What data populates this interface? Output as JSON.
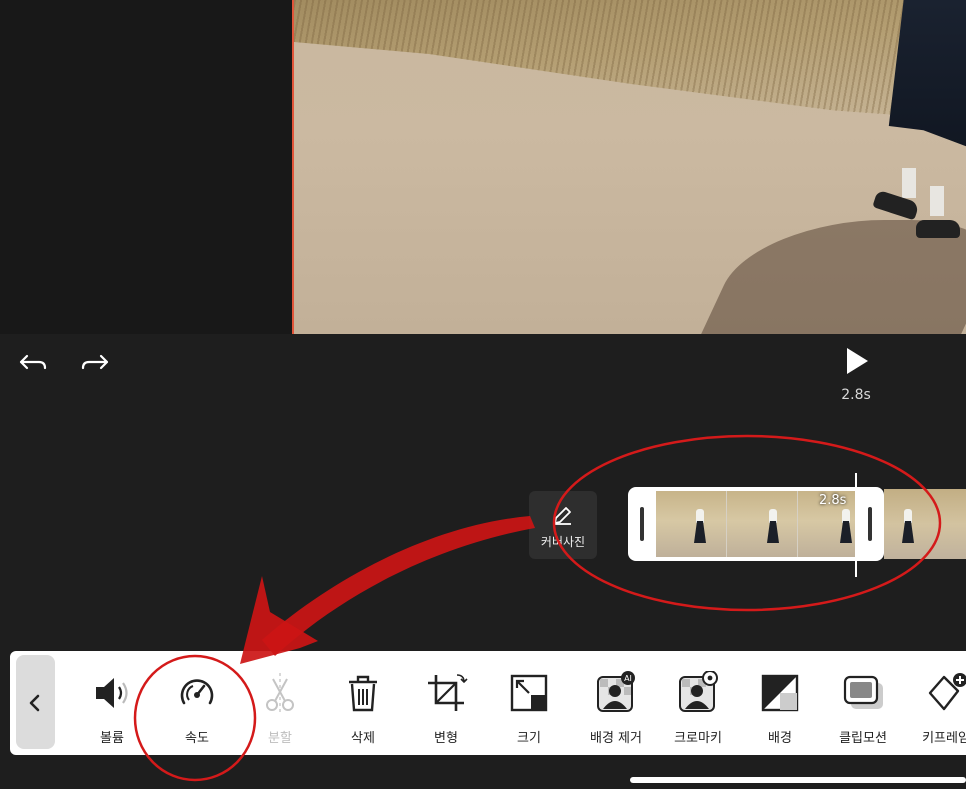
{
  "player": {
    "duration_label": "2.8s"
  },
  "timeline": {
    "cover_photo_label": "커버사진",
    "clip_duration_label": "2.8s"
  },
  "toolbar": {
    "tools": [
      {
        "label": "볼륨",
        "icon": "volume-icon",
        "enabled": true
      },
      {
        "label": "속도",
        "icon": "speedometer-icon",
        "enabled": true
      },
      {
        "label": "분할",
        "icon": "scissors-icon",
        "enabled": false
      },
      {
        "label": "삭제",
        "icon": "trash-icon",
        "enabled": true
      },
      {
        "label": "변형",
        "icon": "crop-rotate-icon",
        "enabled": true
      },
      {
        "label": "크기",
        "icon": "resize-icon",
        "enabled": true
      },
      {
        "label": "배경 제거",
        "icon": "ai-background-remove-icon",
        "enabled": true
      },
      {
        "label": "크로마키",
        "icon": "chroma-key-icon",
        "enabled": true
      },
      {
        "label": "배경",
        "icon": "background-icon",
        "enabled": true
      },
      {
        "label": "클립모션",
        "icon": "clip-motion-icon",
        "enabled": true
      },
      {
        "label": "키프레임",
        "icon": "keyframe-add-icon",
        "enabled": true
      }
    ]
  },
  "annotations": {
    "color": "#d41a1a"
  },
  "colors": {
    "background": "#1e1e1e",
    "toolbar": "#ffffff",
    "preview_border": "#e0553a"
  }
}
